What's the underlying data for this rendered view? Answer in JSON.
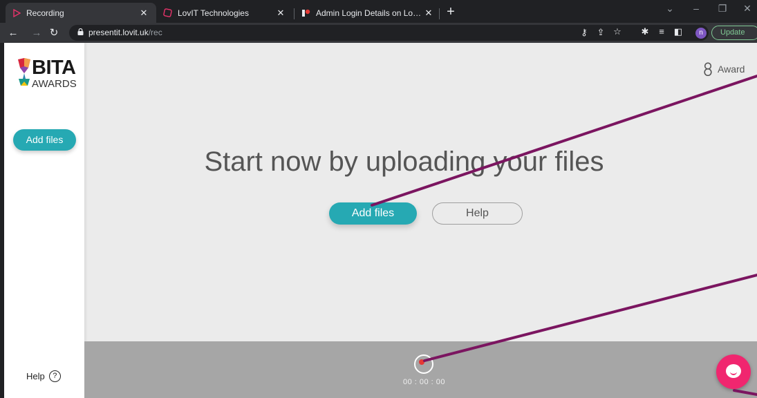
{
  "browser": {
    "tabs": [
      {
        "title": "Recording",
        "active": true
      },
      {
        "title": "LovIT Technologies",
        "active": false
      },
      {
        "title": "Admin Login Details on Lovit Trac",
        "active": false
      }
    ],
    "new_tab": "+",
    "address": {
      "host": "presentit.lovit.uk",
      "path": "/rec"
    },
    "profile_initial": "n",
    "update_label": "Update"
  },
  "sidebar": {
    "logo": {
      "wordmark": "BITA",
      "subtitle": "AWARDS"
    },
    "add_files_label": "Add files",
    "help_label": "Help",
    "help_icon": "?"
  },
  "header": {
    "user_label": "Award"
  },
  "main": {
    "headline": "Start now by uploading your files",
    "add_files_label": "Add files",
    "help_label": "Help"
  },
  "recorder": {
    "timer": "00 : 00 : 00"
  },
  "colors": {
    "accent": "#26a9b3",
    "record": "#e53935",
    "chat": "#f0266f",
    "annotation": "#7b1560"
  }
}
